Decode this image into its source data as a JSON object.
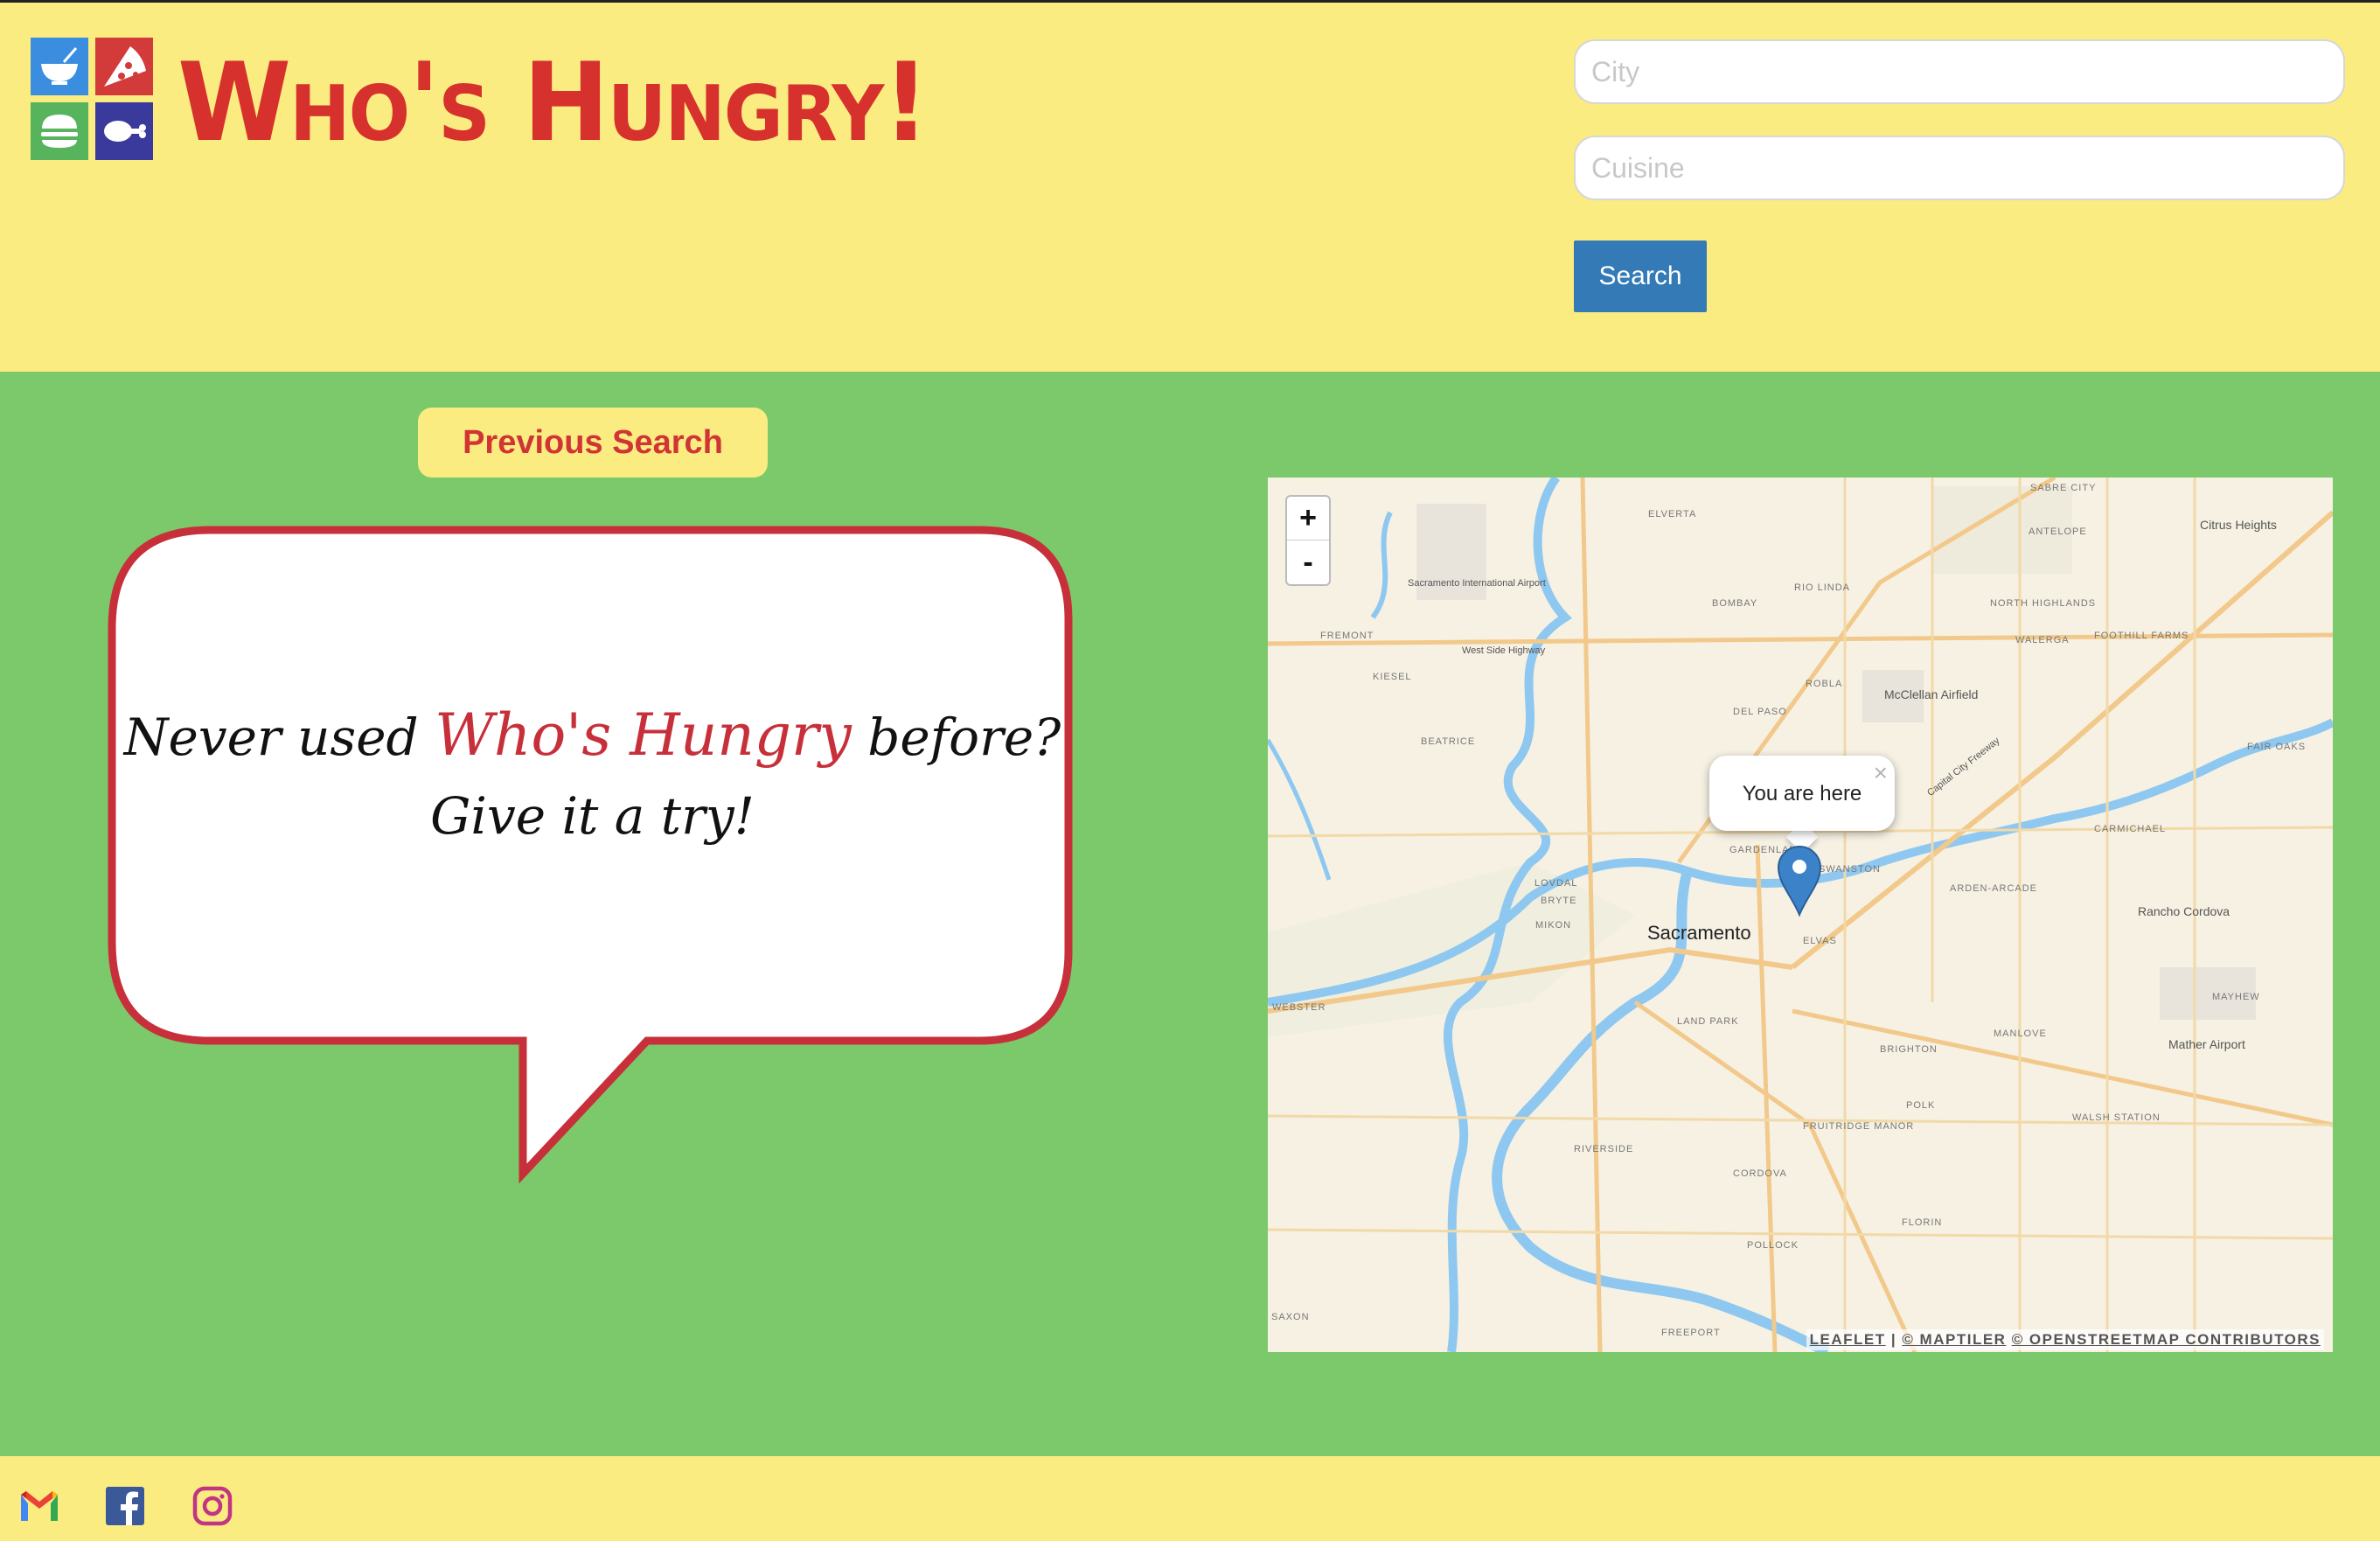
{
  "header": {
    "title": "Who's Hungry!",
    "logo_icons": [
      "bowl-icon",
      "pizza-icon",
      "burger-icon",
      "drumstick-icon"
    ]
  },
  "search": {
    "city_placeholder": "City",
    "city_value": "",
    "cuisine_placeholder": "Cuisine",
    "cuisine_value": "",
    "button_label": "Search"
  },
  "main": {
    "previous_search_label": "Previous Search",
    "bubble": {
      "prefix": "Never used ",
      "brand": "Who's Hungry",
      "suffix": " before?",
      "line2": "Give it a try!"
    }
  },
  "map": {
    "zoom_in": "+",
    "zoom_out": "-",
    "popup_text": "You are here",
    "popup_close": "×",
    "labels": {
      "sacramento": "Sacramento",
      "rancho_cordova": "Rancho Cordova",
      "citrus_heights": "Citrus Heights",
      "mcclellan": "McClellan Airfield",
      "mather": "Mather Airport",
      "sac_airport": "Sacramento International Airport",
      "elverta": "ELVERTA",
      "rio_linda": "RIO LINDA",
      "antelope": "ANTELOPE",
      "sabre_city": "SABRE CITY",
      "north_highlands": "NORTH HIGHLANDS",
      "del_paso": "DEL PASO",
      "foothill_farms": "FOOTHILL FARMS",
      "fair_oaks": "FAIR OAKS",
      "carmichael": "CARMICHAEL",
      "arden_arcade": "ARDEN-ARCADE",
      "land_park": "LAND PARK",
      "elvas": "ELVAS",
      "riverside": "RIVERSIDE",
      "fruitridge_manor": "FRUITRIDGE MANOR",
      "cordova": "CORDOVA",
      "florin": "FLORIN",
      "pollock": "POLLOCK",
      "walsh_station": "WALSH STATION",
      "west_side_highway": "West Side Highway",
      "fremont": "FREMONT",
      "kiesel": "KIESEL",
      "beatrice": "BEATRICE",
      "lovdal": "LOVDAL",
      "bryte": "BRYTE",
      "mikon": "MIKON",
      "webster": "WEBSTER",
      "freeport": "FREEPORT",
      "saxon": "SAXON",
      "brighton": "BRIGHTON",
      "manlove": "MANLOVE",
      "mayhew": "MAYHEW",
      "polk": "POLK",
      "bombay": "BOMBAY",
      "robla": "ROBLA",
      "walerga": "WALERGA",
      "gardenland": "GARDENLAND",
      "swanston": "SWANSTON",
      "capital_city_freeway": "Capital City Freeway"
    },
    "attribution": {
      "leaflet": "LEAFLET",
      "sep": " | ",
      "maptiler": "© MAPTILER",
      "osm": "© OPENSTREETMAP CONTRIBUTORS"
    }
  },
  "footer": {
    "icons": [
      "gmail-icon",
      "facebook-icon",
      "instagram-icon"
    ]
  },
  "colors": {
    "header_bg": "#fbec82",
    "main_bg": "#7bc96b",
    "brand_red": "#d7312e",
    "search_blue": "#337ab7",
    "bubble_border": "#c7303a"
  }
}
